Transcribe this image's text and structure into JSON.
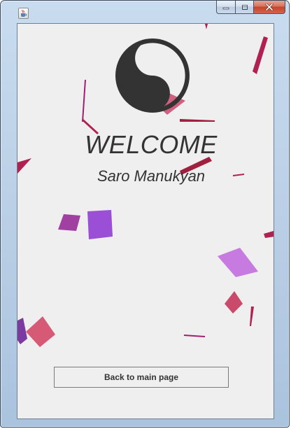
{
  "window": {
    "title": "",
    "app_icon": "java-cup-icon",
    "controls": {
      "minimize_icon": "minimize-icon",
      "maximize_icon": "maximize-icon",
      "close_icon": "close-icon",
      "close_color": "#c7432c"
    }
  },
  "main": {
    "logo_icon": "yin-yang-icon",
    "logo_color": "#333333",
    "background": "#efefef",
    "title": "WELCOME",
    "subtitle": "Saro Manukyan",
    "back_button_label": "Back to main page"
  },
  "decorations": {
    "confetti_colors": [
      "#b02050",
      "#d06080",
      "#9b4fd6",
      "#a040a0",
      "#c77ae0",
      "#c94a6a",
      "#d65a75",
      "#7a3aa0"
    ]
  }
}
